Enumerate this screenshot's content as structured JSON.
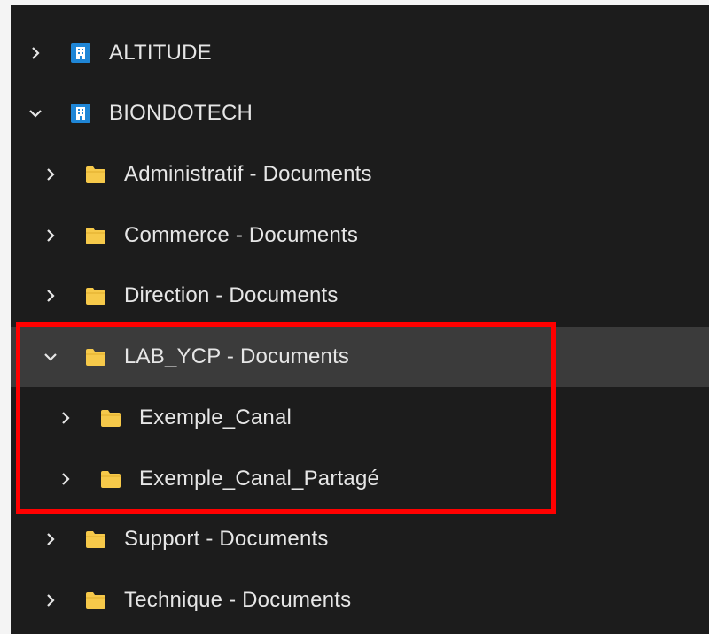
{
  "tree": {
    "items": [
      {
        "label": "ALTITUDE",
        "icon": "sharepoint-site-icon",
        "expanded": false
      },
      {
        "label": "BIONDOTECH",
        "icon": "sharepoint-site-icon",
        "expanded": true
      },
      {
        "label": "Administratif - Documents",
        "icon": "folder-icon",
        "expanded": false
      },
      {
        "label": "Commerce - Documents",
        "icon": "folder-icon",
        "expanded": false
      },
      {
        "label": "Direction - Documents",
        "icon": "folder-icon",
        "expanded": false
      },
      {
        "label": "LAB_YCP - Documents",
        "icon": "folder-icon",
        "expanded": true,
        "selected": true
      },
      {
        "label": "Exemple_Canal",
        "icon": "folder-icon",
        "expanded": false
      },
      {
        "label": "Exemple_Canal_Partagé",
        "icon": "folder-icon",
        "expanded": false
      },
      {
        "label": "Support - Documents",
        "icon": "folder-icon",
        "expanded": false
      },
      {
        "label": "Technique - Documents",
        "icon": "folder-icon",
        "expanded": false
      }
    ]
  },
  "colors": {
    "background": "#1c1c1c",
    "selected_row": "#3b3b3b",
    "text": "#e6e6e6",
    "folder": "#f6c94a",
    "site_icon": "#1f86d6",
    "highlight": "#ff0000"
  }
}
